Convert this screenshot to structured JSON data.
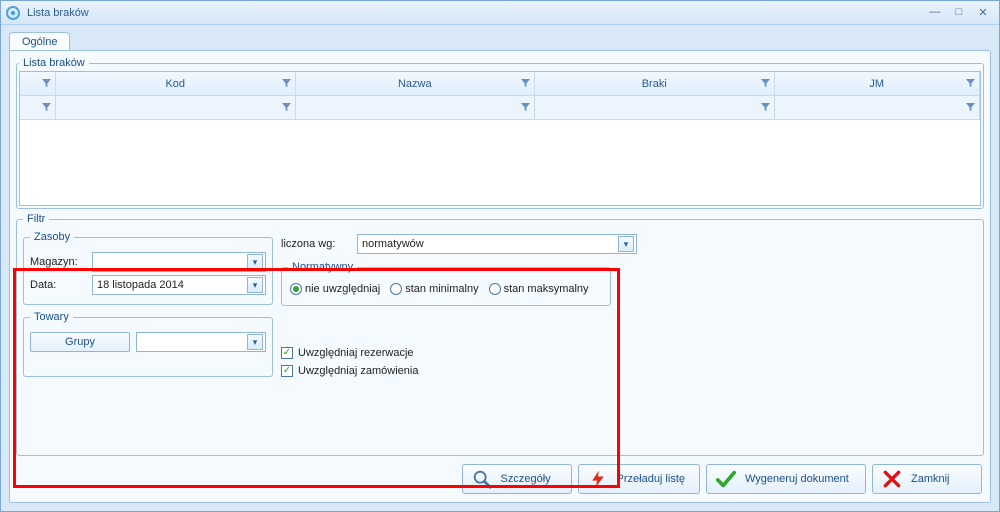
{
  "window": {
    "title": "Lista braków"
  },
  "tabs": {
    "general": "Ogólne"
  },
  "list": {
    "legend": "Lista braków",
    "columns": [
      "",
      "Kod",
      "Nazwa",
      "Braki",
      "JM"
    ]
  },
  "filter": {
    "legend": "Filtr",
    "resources": {
      "legend": "Zasoby",
      "warehouse_label": "Magazyn:",
      "warehouse_value": "",
      "date_label": "Data:",
      "date_value": "18 listopada 2014"
    },
    "goods": {
      "legend": "Towary",
      "groups_button": "Grupy",
      "group_value": ""
    },
    "calc": {
      "label": "liczona wg:",
      "value": "normatywów"
    },
    "norm": {
      "legend": "Normatywny",
      "options": {
        "ignore": "nie uwzględniaj",
        "min": "stan minimalny",
        "max": "stan maksymalny"
      },
      "selected": "ignore"
    },
    "checks": {
      "reservations": "Uwzględniaj rezerwacje",
      "orders": "Uwzględniaj zamówienia",
      "reservations_checked": true,
      "orders_checked": true
    }
  },
  "buttons": {
    "details": "Szczegóły",
    "reload": "Przeładuj listę",
    "generate": "Wygeneruj dokument",
    "close": "Zamknij"
  },
  "colors": {
    "accent": "#1a4f8f",
    "highlight": "#ff0000"
  }
}
